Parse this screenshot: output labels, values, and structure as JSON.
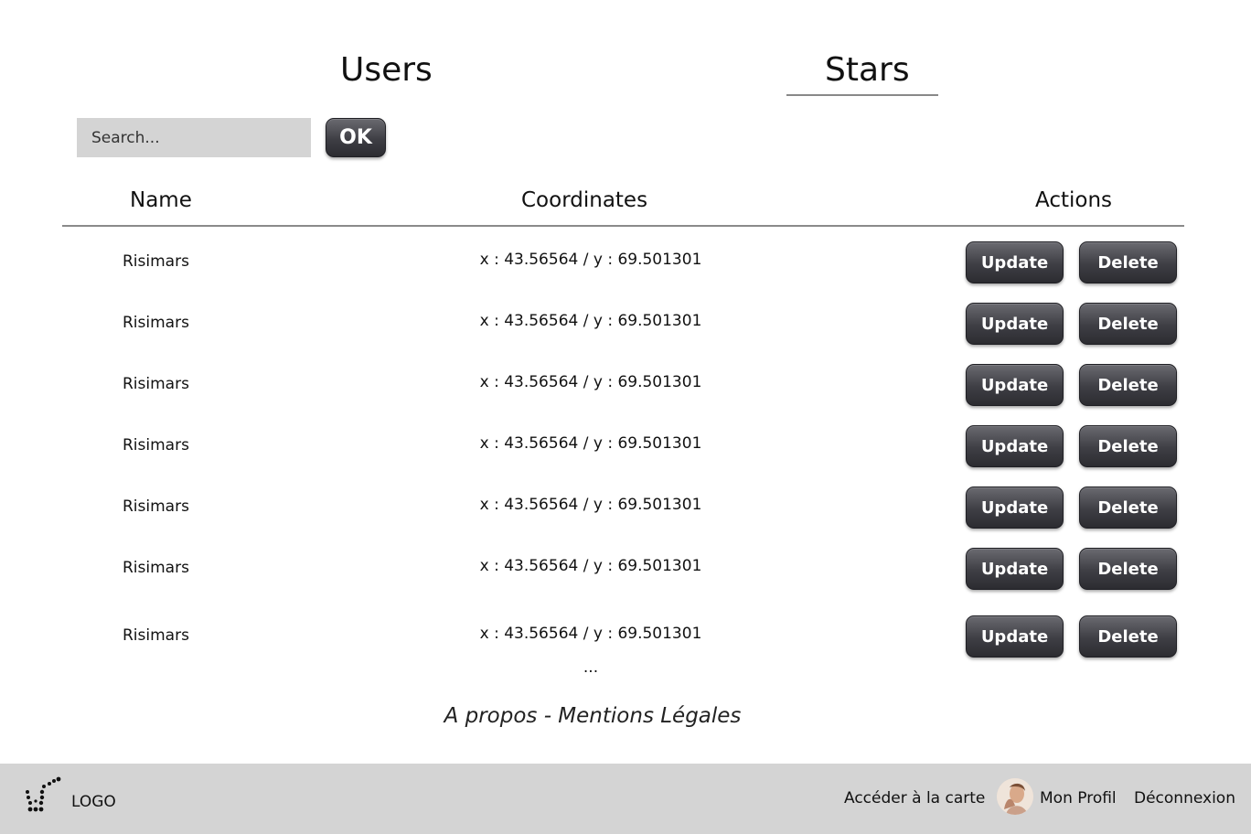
{
  "tabs": {
    "users_label": "Users",
    "stars_label": "Stars",
    "active": "Stars"
  },
  "search": {
    "placeholder": "Search...",
    "value": "",
    "ok_label": "OK"
  },
  "table": {
    "columns": [
      "Name",
      "Coordinates",
      "Actions"
    ],
    "rows": [
      {
        "name": "Risimars",
        "coordinates": "x : 43.56564 / y : 69.501301"
      },
      {
        "name": "Risimars",
        "coordinates": "x : 43.56564 / y : 69.501301"
      },
      {
        "name": "Risimars",
        "coordinates": "x : 43.56564 / y : 69.501301"
      },
      {
        "name": "Risimars",
        "coordinates": "x : 43.56564 / y : 69.501301"
      },
      {
        "name": "Risimars",
        "coordinates": "x : 43.56564 / y : 69.501301"
      },
      {
        "name": "Risimars",
        "coordinates": "x : 43.56564 / y : 69.501301"
      },
      {
        "name": "Risimars",
        "coordinates": "x : 43.56564 / y : 69.501301"
      }
    ],
    "update_label": "Update",
    "delete_label": "Delete",
    "more_indicator": "..."
  },
  "legal_link": "A propos - Mentions Légales",
  "footer": {
    "logo_text": "LOGO",
    "map_link": "Accéder à la carte",
    "profile_link": "Mon Profil",
    "logout_link": "Déconnexion"
  },
  "colors": {
    "button_dark": "#3e3e44",
    "footer_bg": "#d4d4d4",
    "search_bg": "#d4d4d4"
  }
}
